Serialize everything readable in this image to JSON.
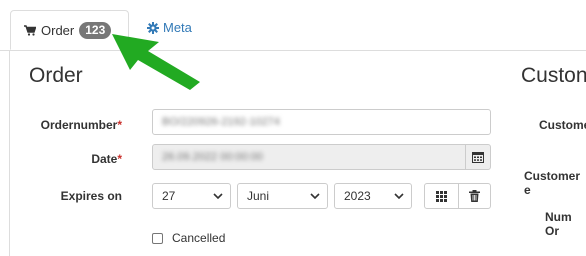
{
  "tabs": {
    "order": {
      "label": "Order",
      "badge": "123",
      "icon": "cart-icon"
    },
    "meta": {
      "label": "Meta",
      "icon": "gear-icon"
    }
  },
  "order": {
    "heading": "Order",
    "ordernumber": {
      "label": "Ordernumber",
      "required": "*",
      "value": "BO/220926-2192-10274"
    },
    "date": {
      "label": "Date",
      "required": "*",
      "value": "26.09.2022 00:00:00"
    },
    "expires": {
      "label": "Expires on",
      "day": "27",
      "month": "Juni",
      "year": "2023"
    },
    "cancelled": {
      "label": "Cancelled",
      "checked": false
    }
  },
  "customer": {
    "heading": "Custon",
    "labels": [
      "Custome",
      "Customer e",
      "Num Or"
    ]
  },
  "colors": {
    "accent": "#337ab7",
    "badge": "#777777",
    "arrow": "#22aa22",
    "required": "#c9302c"
  }
}
